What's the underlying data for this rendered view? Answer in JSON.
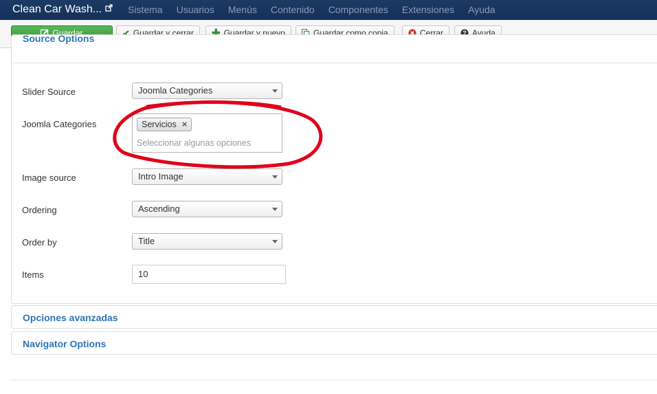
{
  "navbar": {
    "brand": "Clean Car Wash...",
    "brand_icon": "external-link-icon",
    "menu": [
      "Sistema",
      "Usuarios",
      "Menús",
      "Contenido",
      "Componentes",
      "Extensiones",
      "Ayuda"
    ]
  },
  "toolbar": {
    "save": "Guardar",
    "save_close": "Guardar y cerrar",
    "save_new": "Guardar y nuevo",
    "save_copy": "Guardar como copia",
    "close": "Cerrar",
    "help": "Ayuda"
  },
  "source_options": {
    "title": "Source Options",
    "slider_source": {
      "label": "Slider Source",
      "value": "Joomla Categories"
    },
    "joomla_categories": {
      "label": "Joomla Categories",
      "selected": [
        "Servicios"
      ],
      "placeholder": "Seleccionar algunas opciones"
    },
    "image_source": {
      "label": "Image source",
      "value": "Intro Image"
    },
    "ordering": {
      "label": "Ordering",
      "value": "Ascending"
    },
    "order_by": {
      "label": "Order by",
      "value": "Title"
    },
    "items": {
      "label": "Items",
      "value": "10"
    }
  },
  "accordions": {
    "advanced": "Opciones avanzadas",
    "navigator": "Navigator Options"
  },
  "colors": {
    "navbar": "#1d3a64",
    "save_green": "#4aa84a",
    "link_blue": "#2f74b5",
    "annotation_red": "#e0001a"
  }
}
